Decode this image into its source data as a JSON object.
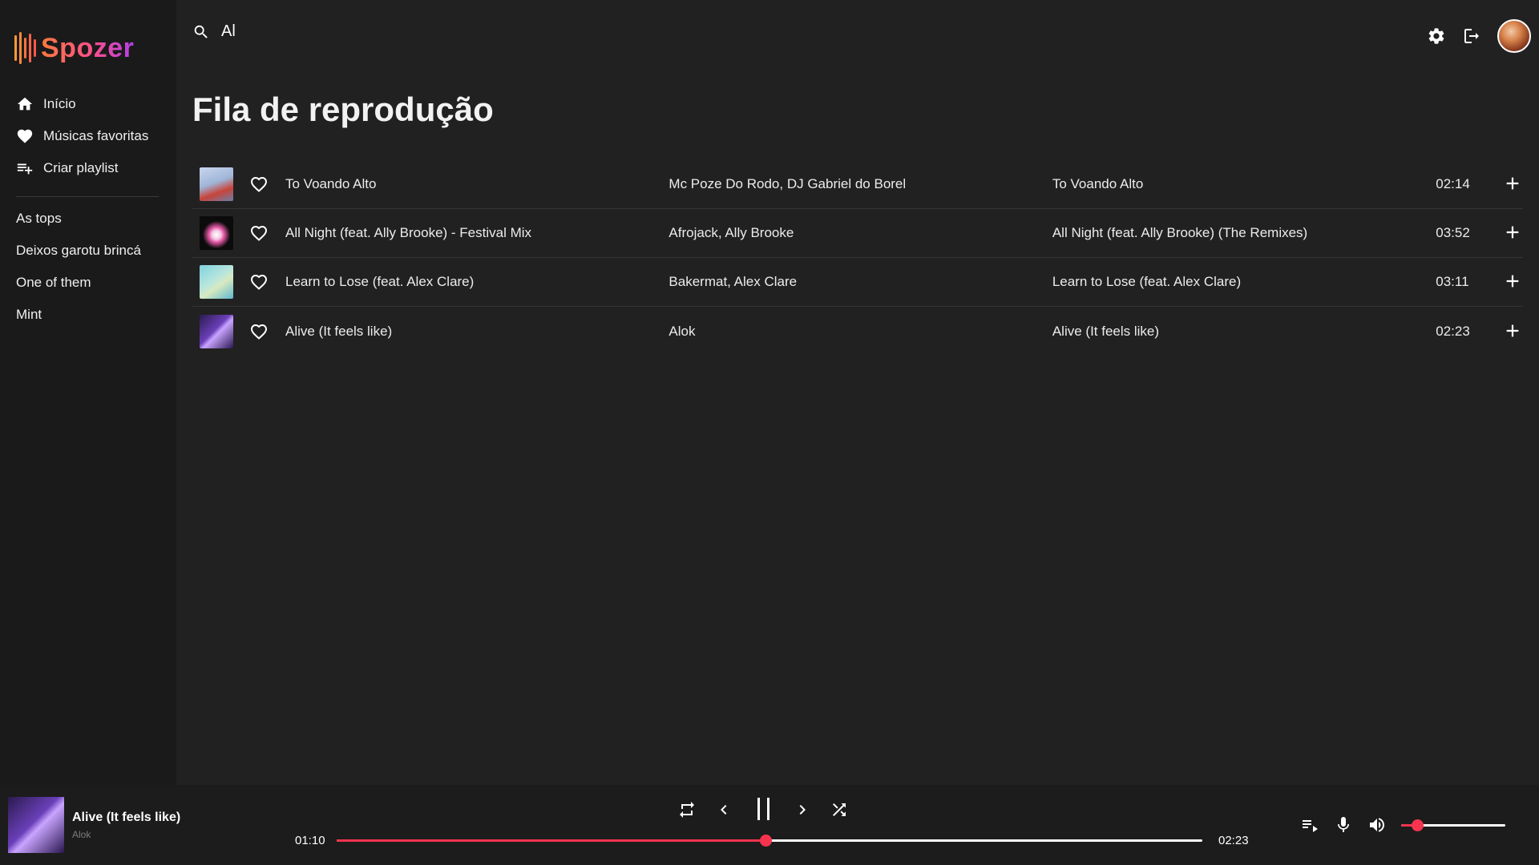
{
  "app": {
    "name": "Spozer",
    "accent": "#f6344e"
  },
  "sidebar": {
    "nav": [
      {
        "label": "Início",
        "icon": "home-icon"
      },
      {
        "label": "Músicas favoritas",
        "icon": "heart-icon"
      },
      {
        "label": "Criar playlist",
        "icon": "playlist-add-icon"
      }
    ],
    "playlists": [
      "As tops",
      "Deixos garotu brincá",
      "One of them",
      "Mint"
    ]
  },
  "header": {
    "search_value": "Al",
    "icons": [
      "search-icon",
      "settings-icon",
      "logout-icon",
      "avatar"
    ]
  },
  "main": {
    "title": "Fila de reprodução",
    "queue": [
      {
        "title": "To Voando Alto",
        "artists": "Mc Poze Do Rodo, DJ Gabriel do Borel",
        "album": "To Voando Alto",
        "duration": "02:14",
        "cover_colors": [
          "#c9d6ee",
          "#c8443a"
        ]
      },
      {
        "title": "All Night (feat. Ally Brooke) - Festival Mix",
        "artists": "Afrojack, Ally Brooke",
        "album": "All Night (feat. Ally Brooke) (The Remixes)",
        "duration": "03:52",
        "cover_colors": [
          "#0b0b0b",
          "#e85aa8"
        ]
      },
      {
        "title": "Learn to Lose (feat. Alex Clare)",
        "artists": "Bakermat, Alex Clare",
        "album": "Learn to Lose (feat. Alex Clare)",
        "duration": "03:11",
        "cover_colors": [
          "#7fd3e0",
          "#d8e9c0"
        ]
      },
      {
        "title": "Alive (It feels like)",
        "artists": "Alok",
        "album": "Alive (It feels like)",
        "duration": "02:23",
        "cover_colors": [
          "#2b1b4e",
          "#9c6fe0"
        ]
      }
    ]
  },
  "player": {
    "now_playing_title": "Alive (It feels like)",
    "now_playing_artist": "Alok",
    "current_time": "01:10",
    "total_time": "02:23",
    "progress": 0.495,
    "volume": 0.15,
    "controls": [
      "repeat-icon",
      "previous-icon",
      "pause-icon",
      "next-icon",
      "shuffle-icon"
    ],
    "right_controls": [
      "queue-icon",
      "microphone-icon",
      "volume-icon"
    ]
  }
}
